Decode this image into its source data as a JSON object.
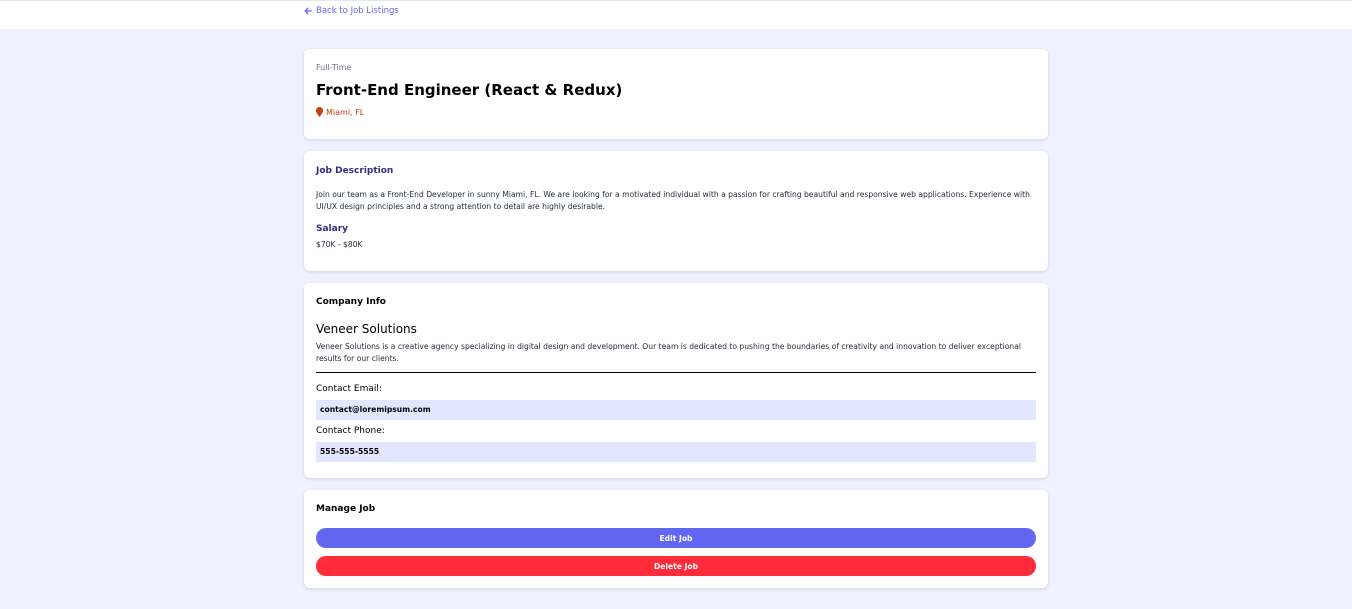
{
  "nav": {
    "back_label": "Back to Job Listings"
  },
  "job": {
    "type": "Full-Time",
    "title": "Front-End Engineer (React & Redux)",
    "location": "Miami, FL"
  },
  "description": {
    "heading": "Job Description",
    "text": "Join our team as a Front-End Developer in sunny Miami, FL. We are looking for a motivated individual with a passion for crafting beautiful and responsive web applications. Experience with UI/UX design principles and a strong attention to detail are highly desirable.",
    "salary_heading": "Salary",
    "salary": "$70K - $80K"
  },
  "company": {
    "heading": "Company Info",
    "name": "Veneer Solutions",
    "description": "Veneer Solutions is a creative agency specializing in digital design and development. Our team is dedicated to pushing the boundaries of creativity and innovation to deliver exceptional results for our clients.",
    "email_label": "Contact Email:",
    "email": "contact@loremipsum.com",
    "phone_label": "Contact Phone:",
    "phone": "555-555-5555"
  },
  "manage": {
    "heading": "Manage Job",
    "edit_label": "Edit Job",
    "delete_label": "Delete Job"
  },
  "colors": {
    "accent": "#6366f1",
    "danger": "#ff2a3a",
    "location": "#c2410c",
    "background": "#eef2ff",
    "contact_bg": "#e0e7ff"
  },
  "icons": {
    "back": "arrow-left-icon",
    "location": "map-marker-icon"
  }
}
